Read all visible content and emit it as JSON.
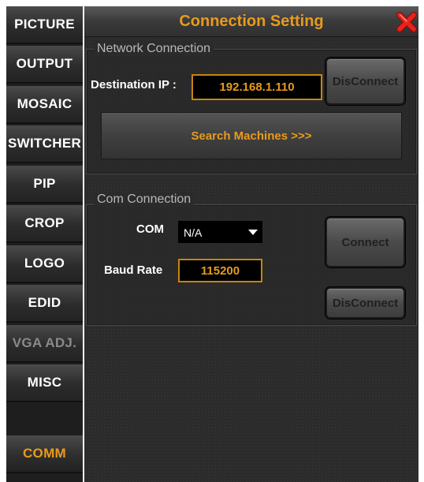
{
  "sidebar": {
    "items": [
      {
        "label": "PICTURE",
        "state": "normal"
      },
      {
        "label": "OUTPUT",
        "state": "normal"
      },
      {
        "label": "MOSAIC",
        "state": "normal"
      },
      {
        "label": "SWITCHER",
        "state": "normal"
      },
      {
        "label": "PIP",
        "state": "normal"
      },
      {
        "label": "CROP",
        "state": "normal"
      },
      {
        "label": "LOGO",
        "state": "normal"
      },
      {
        "label": "EDID",
        "state": "normal"
      },
      {
        "label": "VGA ADJ.",
        "state": "disabled"
      },
      {
        "label": "MISC",
        "state": "normal"
      },
      {
        "label": "COMM",
        "state": "active"
      }
    ]
  },
  "window": {
    "title": "Connection Setting",
    "close_icon": "close-x-icon"
  },
  "network": {
    "legend": "Network Connection",
    "ip_label": "Destination IP :",
    "ip_value": "192.168.1.110",
    "disconnect_label": "DisConnect",
    "search_label": "Search Machines >>>"
  },
  "com": {
    "legend": "Com Connection",
    "com_label": "COM",
    "com_value": "N/A",
    "baud_label": "Baud Rate",
    "baud_value": "115200",
    "connect_label": "Connect",
    "disconnect_label": "DisConnect"
  },
  "colors": {
    "accent": "#e89b1c",
    "panel": "#2b2b2b",
    "close": "#e8231c"
  }
}
